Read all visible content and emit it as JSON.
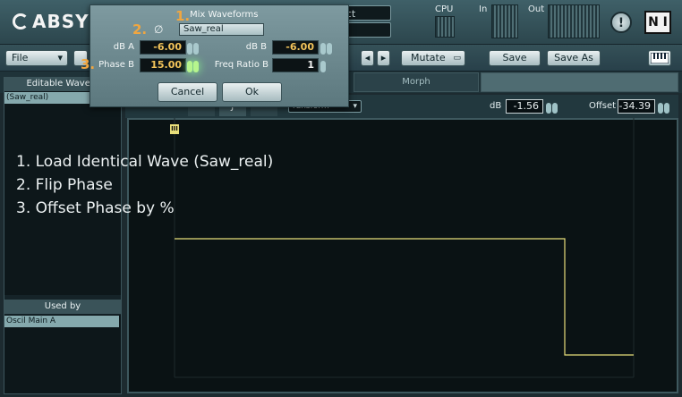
{
  "header": {
    "logo": "ABSYN",
    "lcd1": "ect",
    "lcd2": "o",
    "cpu_label": "CPU",
    "in_label": "In",
    "out_label": "Out",
    "alert_icon": "exclamation-icon",
    "ni_badge": "N I"
  },
  "toolbar": {
    "file_label": "File",
    "prev_icon": "chevron-left-icon",
    "next_icon": "chevron-right-icon",
    "mutate_label": "Mutate",
    "save_label": "Save",
    "save_as_label": "Save As",
    "keyboard_icon": "piano-keyboard-icon"
  },
  "tabs": {
    "morph_label": "Morph"
  },
  "left_panel": {
    "title": "Editable Wavefo",
    "items": [
      "(Saw_real)"
    ],
    "used_by_title": "Used by",
    "used_by_items": [
      "Oscil Main A"
    ]
  },
  "editor": {
    "mode_select": "ransform",
    "db_label": "dB",
    "db_value": "-1.56",
    "offset_label": "Offset",
    "offset_value": "-34.39",
    "marker": "III"
  },
  "dialog": {
    "title": "Mix Waveforms",
    "phase_icon": "phase-invert-icon",
    "waveform_select": "Saw_real",
    "db_a_label": "dB A",
    "db_a_value": "-6.00",
    "db_b_label": "dB B",
    "db_b_value": "-6.00",
    "phase_b_label": "Phase B",
    "phase_b_value": "15.00",
    "freq_ratio_label": "Freq Ratio B",
    "freq_ratio_value": "1",
    "cancel_label": "Cancel",
    "ok_label": "Ok"
  },
  "callouts": {
    "n1": "1.",
    "n2": "2.",
    "n3": "3."
  },
  "notes": [
    "1. Load Identical Wave (Saw_real)",
    "2. Flip Phase",
    "3. Offset Phase by %"
  ],
  "colors": {
    "waveform": "#e8de7a",
    "callout": "#f0a640",
    "dialog_value": "#f3c45a"
  }
}
